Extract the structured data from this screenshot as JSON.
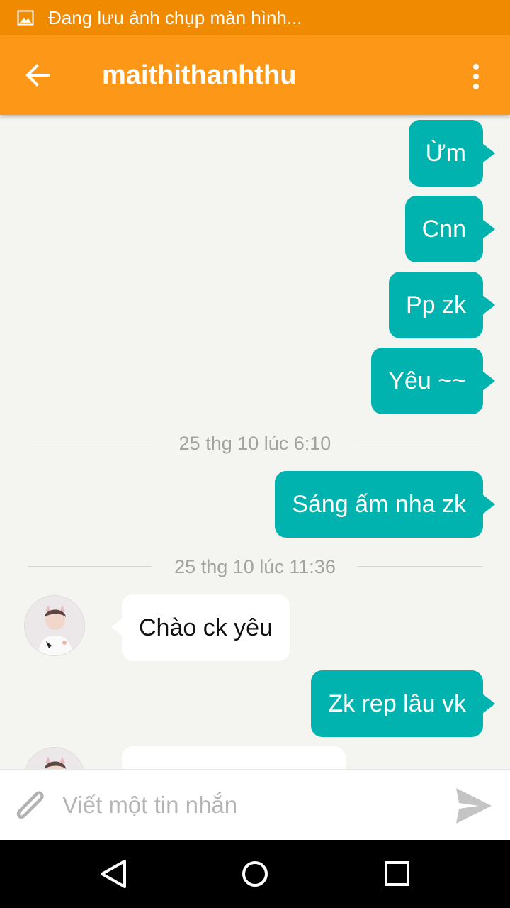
{
  "status_bar": {
    "text": "Đang lưu ảnh chụp màn hình...",
    "icon": "image-icon"
  },
  "header": {
    "title": "maithithanhthu",
    "back_icon": "arrow-back-icon",
    "menu_icon": "more-vertical-icon",
    "color": "#fd9717"
  },
  "messages": [
    {
      "side": "out",
      "text": "Ừm"
    },
    {
      "side": "out",
      "text": "Cnn"
    },
    {
      "side": "out",
      "text": "Pp zk"
    },
    {
      "side": "out",
      "text": "Yêu ~~"
    },
    {
      "side": "separator",
      "text": "25 thg 10 lúc 6:10"
    },
    {
      "side": "out",
      "text": "Sáng ấm nha zk"
    },
    {
      "side": "separator",
      "text": "25 thg 10 lúc 11:36"
    },
    {
      "side": "in",
      "text": "Chào ck yêu"
    },
    {
      "side": "out",
      "text": "Zk rep lâu vk"
    },
    {
      "side": "in",
      "text": ""
    }
  ],
  "composer": {
    "placeholder": "Viết một tin nhắn",
    "attach_icon": "paperclip-icon",
    "send_icon": "send-icon"
  },
  "nav": {
    "back_icon": "nav-back-icon",
    "home_icon": "nav-home-icon",
    "recents_icon": "nav-recents-icon"
  },
  "colors": {
    "outgoing_bubble": "#00b3ae",
    "incoming_bubble": "#ffffff",
    "status_bar": "#f08a00",
    "chat_background": "#f4f4f0"
  }
}
